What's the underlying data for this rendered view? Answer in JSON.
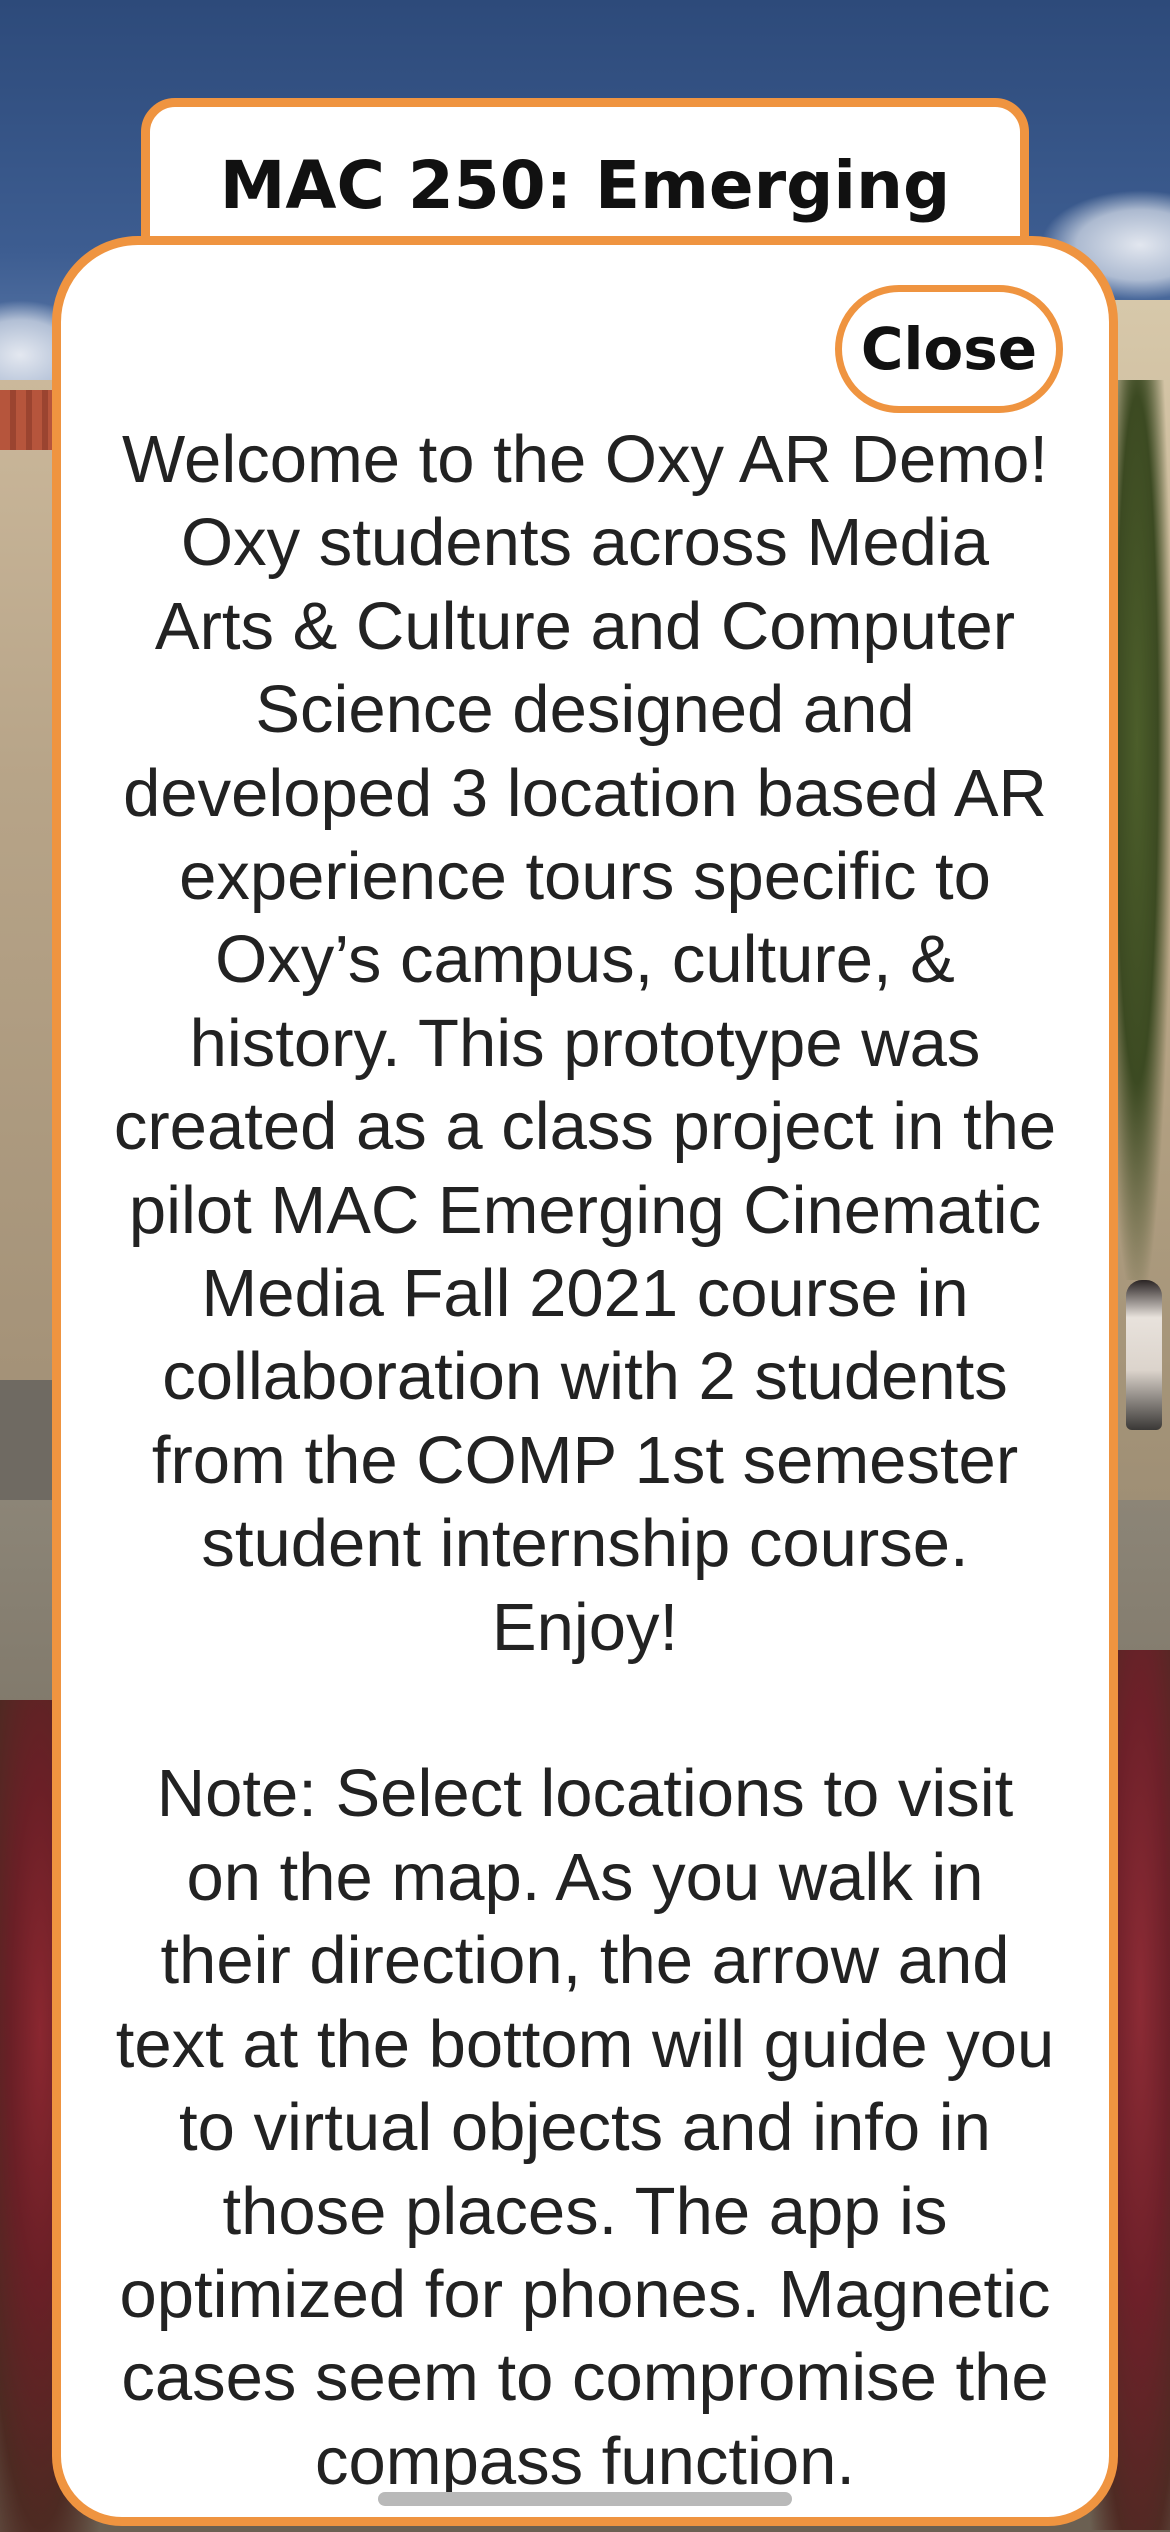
{
  "dialog": {
    "title": "MAC 250: Emerging",
    "close_label": "Close",
    "intro_lines": [
      "Welcome to the Oxy AR Demo!",
      "Oxy students across Media",
      "Arts & Culture and Computer",
      "Science designed and",
      "developed 3 location based AR",
      "experience tours specific to",
      "Oxy’s campus, culture, &",
      "history. This prototype was",
      "created as a class project in the",
      "pilot MAC Emerging Cinematic",
      "Media Fall 2021 course in",
      "collaboration with 2 students",
      "from the COMP 1st semester",
      "student internship course.",
      "Enjoy!"
    ],
    "note_lines": [
      "Note: Select locations to visit",
      "on the map. As you walk in",
      "their direction, the arrow and",
      "text at the bottom will guide you",
      "to virtual objects and info in",
      "those places. The app is",
      "optimized for phones. Magnetic",
      "cases seem to compromise the",
      "compass function."
    ]
  },
  "colors": {
    "accent": "#ef9440",
    "card_background": "#ffffff",
    "text": "#222222"
  }
}
